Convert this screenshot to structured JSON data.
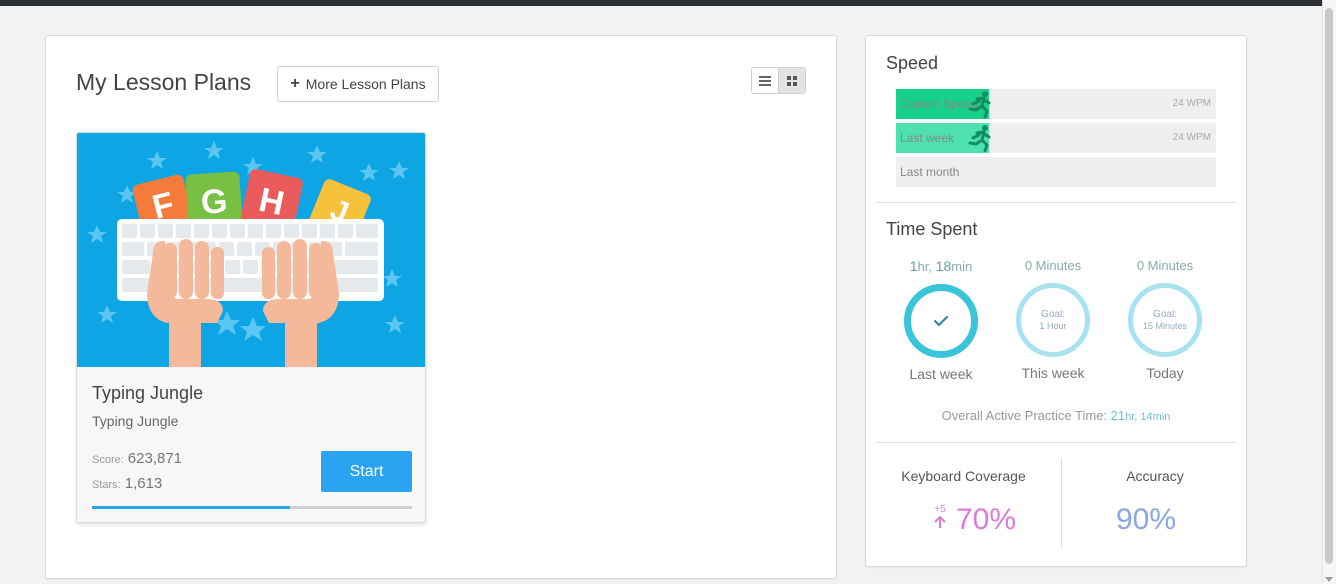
{
  "header": {
    "title": "My Lesson Plans",
    "more_button": "More Lesson Plans"
  },
  "view_toggle": {
    "active": "grid",
    "list_icon": "list-icon",
    "grid_icon": "grid-icon"
  },
  "lesson_card": {
    "image_keys": [
      "F",
      "G",
      "H",
      "J"
    ],
    "title": "Typing Jungle",
    "subtitle": "Typing Jungle",
    "score_label": "Score:",
    "score": "623,871",
    "stars_label": "Stars:",
    "stars": "1,613",
    "start_button": "Start",
    "progress_fraction": 0.62
  },
  "speed": {
    "title": "Speed",
    "bars": [
      {
        "label": "Current Speed",
        "wpm": "24 WPM",
        "fill_fraction": 0.29,
        "color": "#16d18a"
      },
      {
        "label": "Last week",
        "wpm": "24 WPM",
        "fill_fraction": 0.29,
        "color": "#4fe0b2"
      },
      {
        "label": "Last month",
        "wpm": "",
        "fill_fraction": 0,
        "color": "#efefef"
      }
    ]
  },
  "time_spent": {
    "title": "Time Spent",
    "columns": [
      {
        "top_num1": "1",
        "top_unit1": "hr, ",
        "top_num2": "18",
        "top_unit2": "min",
        "goal_line1": "",
        "goal_line2": "",
        "label": "Last week",
        "complete": true
      },
      {
        "top": "0 Minutes",
        "goal_line1": "Goal:",
        "goal_line2": "1 Hour",
        "label": "This week",
        "complete": false
      },
      {
        "top": "0 Minutes",
        "goal_line1": "Goal:",
        "goal_line2": "15 Minutes",
        "label": "Today",
        "complete": false
      }
    ],
    "overall_label": "Overall Active Practice Time: ",
    "overall_h": "21",
    "overall_h_unit": "hr, ",
    "overall_m": "14",
    "overall_m_unit": "min"
  },
  "keyboard_coverage": {
    "label": "Keyboard Coverage",
    "value": "70%",
    "delta": "+5",
    "color": "#e07ad8"
  },
  "accuracy": {
    "label": "Accuracy",
    "value": "90%",
    "color": "#8aa6e6"
  }
}
